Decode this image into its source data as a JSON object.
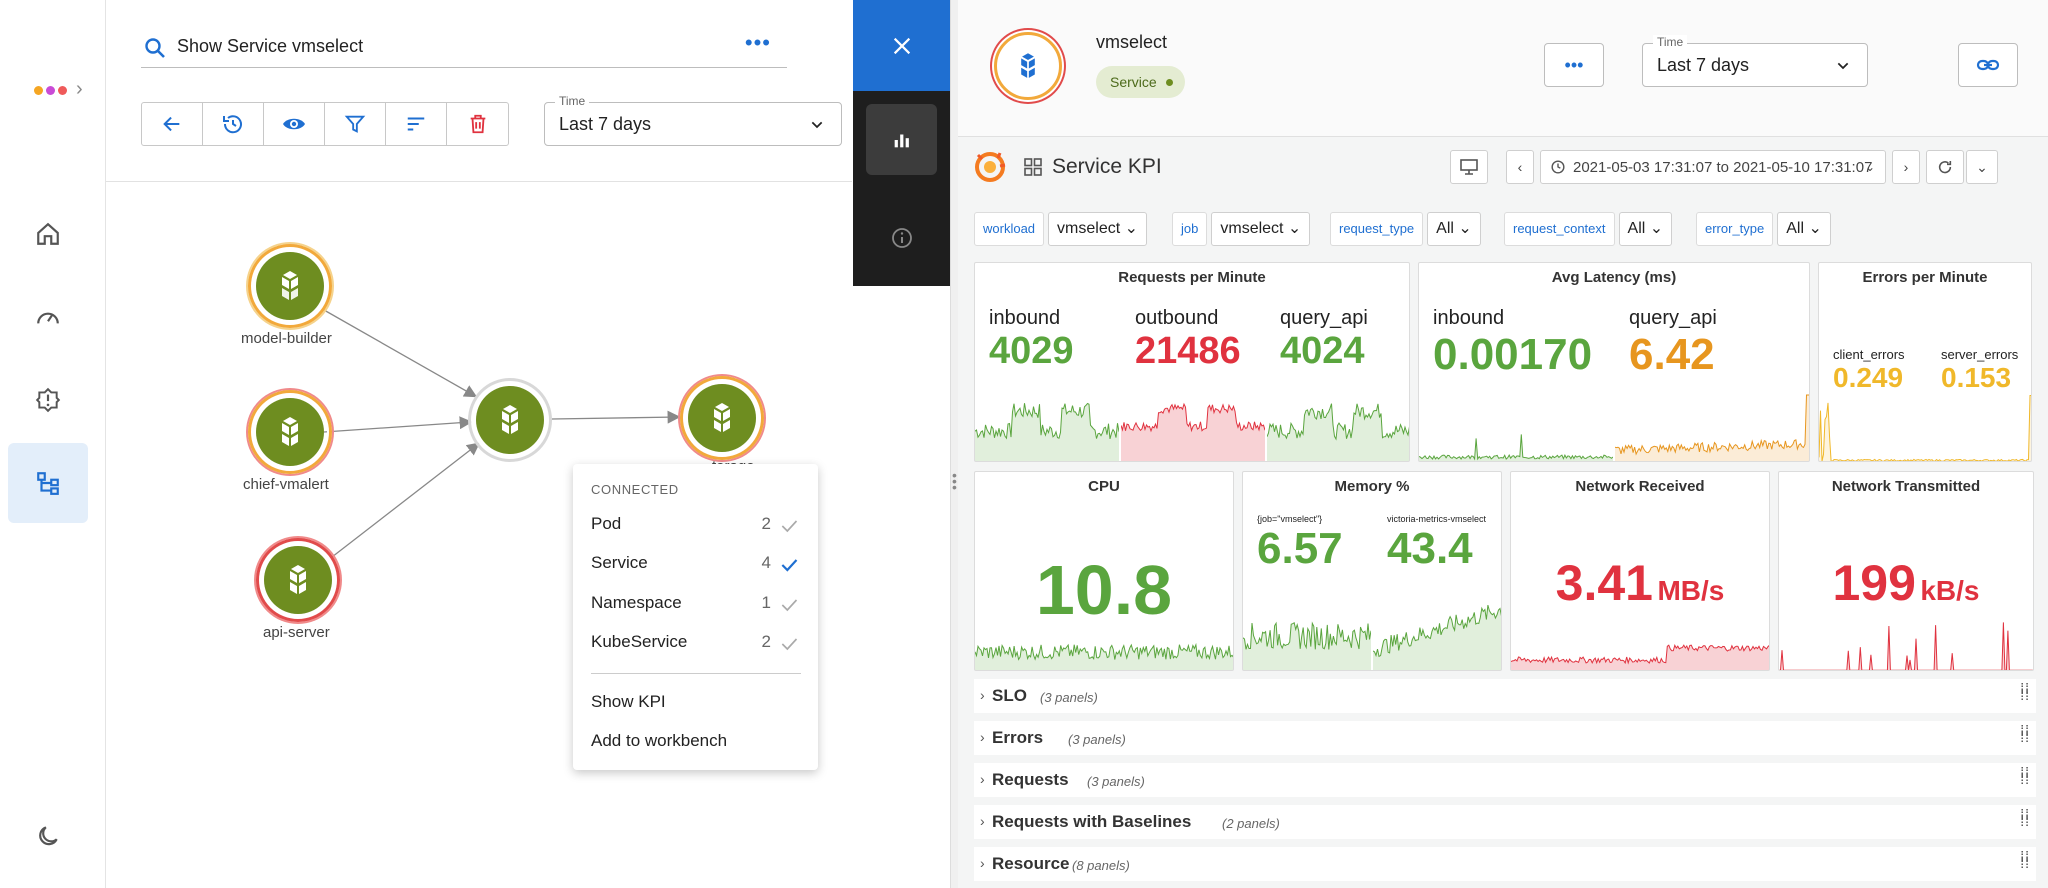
{
  "search": {
    "value": "Show Service vmselect"
  },
  "time": {
    "label": "Time",
    "value": "Last 7 days"
  },
  "nodes": [
    {
      "label": "model-builder"
    },
    {
      "label": "chief-vmalert"
    },
    {
      "label": "api-server"
    },
    {
      "label": "torage"
    }
  ],
  "context_menu": {
    "header": "CONNECTED",
    "items": [
      {
        "label": "Pod",
        "count": "2",
        "checked": false
      },
      {
        "label": "Service",
        "count": "4",
        "checked": true
      },
      {
        "label": "Namespace",
        "count": "1",
        "checked": false
      },
      {
        "label": "KubeService",
        "count": "2",
        "checked": false
      }
    ],
    "actions": [
      "Show KPI",
      "Add to workbench"
    ]
  },
  "detail": {
    "name": "vmselect",
    "badge": "Service",
    "time_label": "Time",
    "time_value": "Last 7 days"
  },
  "grafana": {
    "title": "Service KPI",
    "time_range": "2021-05-03 17:31:07 to 2021-05-10 17:31:07",
    "variables": [
      {
        "name": "workload",
        "value": "vmselect"
      },
      {
        "name": "job",
        "value": "vmselect"
      },
      {
        "name": "request_type",
        "value": "All"
      },
      {
        "name": "request_context",
        "value": "All"
      },
      {
        "name": "error_type",
        "value": "All"
      }
    ],
    "panels": {
      "rpm": {
        "title": "Requests per Minute",
        "stats": [
          {
            "label": "inbound",
            "value": "4029"
          },
          {
            "label": "outbound",
            "value": "21486"
          },
          {
            "label": "query_api",
            "value": "4024"
          }
        ]
      },
      "latency": {
        "title": "Avg Latency (ms)",
        "stats": [
          {
            "label": "inbound",
            "value": "0.00170"
          },
          {
            "label": "query_api",
            "value": "6.42"
          }
        ]
      },
      "errors": {
        "title": "Errors per Minute",
        "stats": [
          {
            "label": "client_errors",
            "value": "0.249"
          },
          {
            "label": "server_errors",
            "value": "0.153"
          }
        ]
      },
      "cpu": {
        "title": "CPU",
        "value": "10.8"
      },
      "memory": {
        "title": "Memory %",
        "stats": [
          {
            "label": "{job=\"vmselect\"}",
            "value": "6.57"
          },
          {
            "label": "victoria-metrics-vmselect",
            "value": "43.4"
          }
        ]
      },
      "net_rx": {
        "title": "Network Received",
        "value": "3.41",
        "unit": "MB/s"
      },
      "net_tx": {
        "title": "Network Transmitted",
        "value": "199",
        "unit": "kB/s"
      }
    },
    "rows": [
      {
        "title": "SLO",
        "count": "(3 panels)"
      },
      {
        "title": "Errors",
        "count": "(3 panels)"
      },
      {
        "title": "Requests",
        "count": "(3 panels)"
      },
      {
        "title": "Requests with Baselines",
        "count": "(2 panels)"
      },
      {
        "title": "Resource",
        "count": "(8 panels)"
      }
    ]
  },
  "colors": {
    "accent": "#1f6fd1",
    "node_green": "#6e8d20",
    "ok": "#5aa53e",
    "bad": "#e0323f",
    "warn": "#e7961f"
  }
}
